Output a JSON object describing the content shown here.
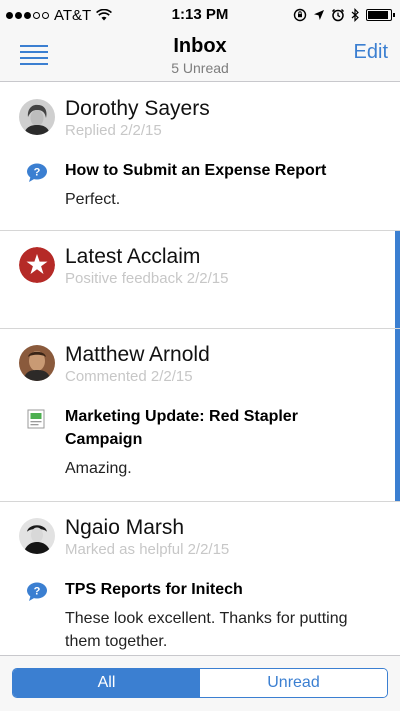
{
  "status_bar": {
    "carrier": "AT&T",
    "time": "1:13 PM",
    "battery_level": 0.9
  },
  "nav": {
    "title": "Inbox",
    "subtitle": "5 Unread",
    "edit_label": "Edit"
  },
  "feed": [
    {
      "name": "Dorothy Sayers",
      "meta": "Replied 2/2/15",
      "post_icon": "chat-bubble-icon",
      "post_title": "How to Submit an Expense Report",
      "post_body": "Perfect.",
      "unread": false
    },
    {
      "name": "Latest Acclaim",
      "meta": "Positive feedback 2/2/15",
      "unread": true
    },
    {
      "name": "Matthew Arnold",
      "meta": "Commented 2/2/15",
      "post_icon": "document-icon",
      "post_title": "Marketing Update: Red Stapler Campaign",
      "post_body": "Amazing.",
      "unread": true
    },
    {
      "name": "Ngaio Marsh",
      "meta": "Marked as helpful 2/2/15",
      "post_icon": "chat-bubble-icon",
      "post_title": "TPS Reports for Initech",
      "post_body": "These look excellent. Thanks for putting them together.",
      "unread": false
    }
  ],
  "filter": {
    "all_label": "All",
    "unread_label": "Unread",
    "selected": "All"
  },
  "colors": {
    "accent": "#3b7fd1",
    "meta_text": "#c7c7c7",
    "acclaim_red": "#b52a27"
  }
}
